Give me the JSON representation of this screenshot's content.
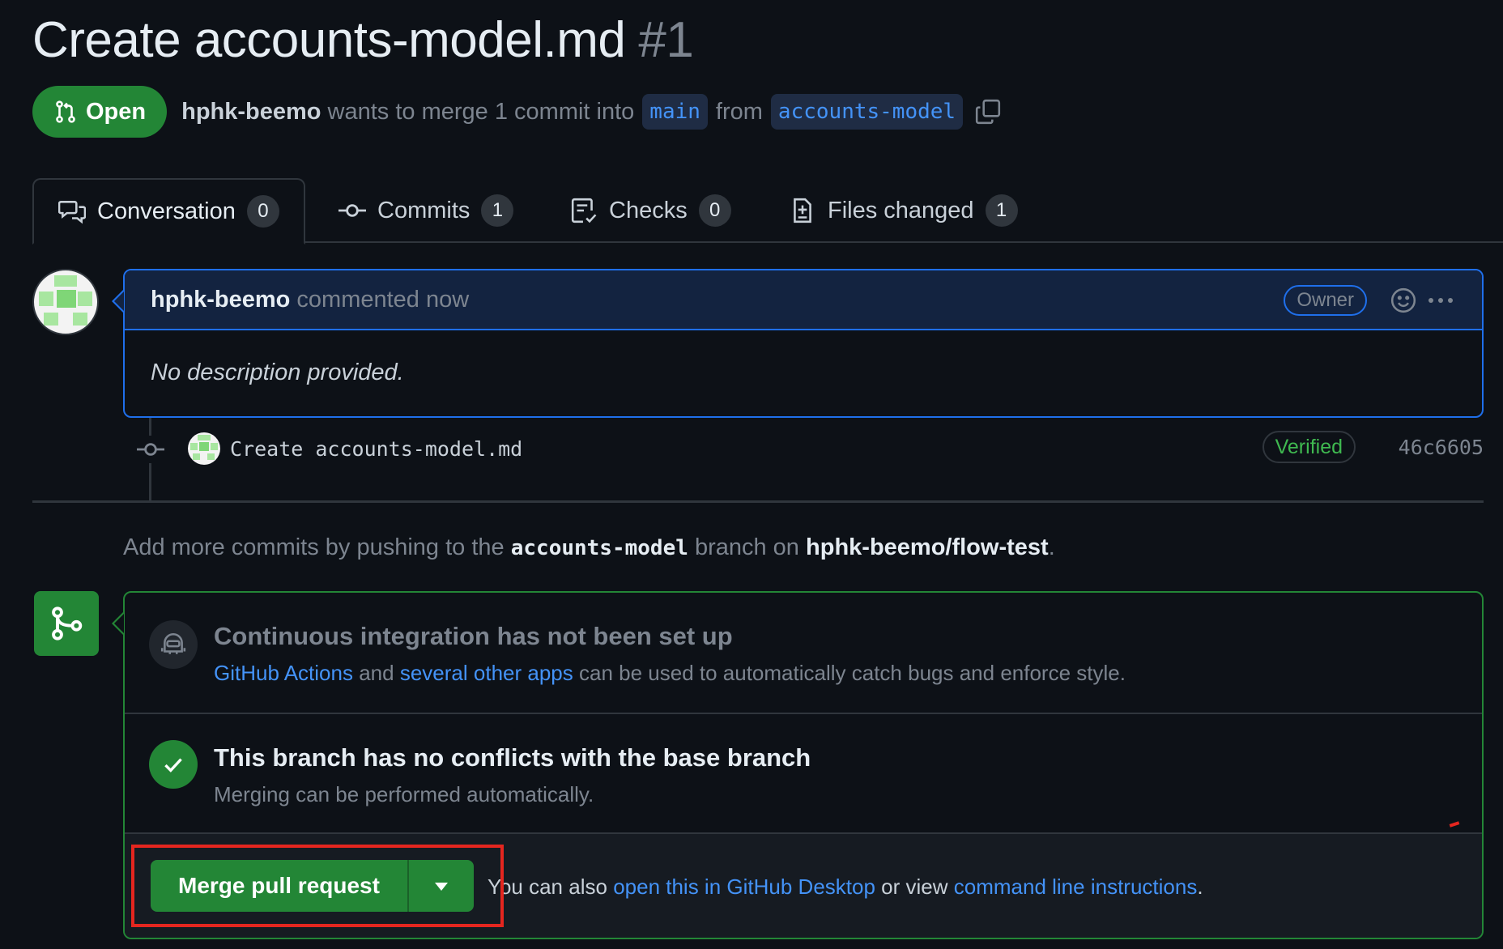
{
  "pr": {
    "title": "Create accounts-model.md",
    "number": "#1",
    "state": "Open",
    "author": "hphk-beemo",
    "summary_mid": "wants to merge 1 commit into",
    "base_branch": "main",
    "from_word": "from",
    "head_branch": "accounts-model"
  },
  "tabs": [
    {
      "label": "Conversation",
      "count": "0",
      "icon": "comment-discussion-icon"
    },
    {
      "label": "Commits",
      "count": "1",
      "icon": "git-commit-icon"
    },
    {
      "label": "Checks",
      "count": "0",
      "icon": "checklist-icon"
    },
    {
      "label": "Files changed",
      "count": "1",
      "icon": "file-diff-icon"
    }
  ],
  "comment": {
    "author": "hphk-beemo",
    "meta": "commented now",
    "role_badge": "Owner",
    "body": "No description provided."
  },
  "commit": {
    "message": "Create accounts-model.md",
    "verified": "Verified",
    "sha": "46c6605"
  },
  "hint": {
    "prefix": "Add more commits by pushing to the",
    "branch": "accounts-model",
    "middle": "branch on",
    "repo": "hphk-beemo/flow-test",
    "suffix": "."
  },
  "checks": {
    "ci_title": "Continuous integration has not been set up",
    "ci_link1": "GitHub Actions",
    "ci_and": "and",
    "ci_link2": "several other apps",
    "ci_rest": "can be used to automatically catch bugs and enforce style.",
    "conflict_title": "This branch has no conflicts with the base branch",
    "conflict_sub": "Merging can be performed automatically."
  },
  "merge": {
    "button_label": "Merge pull request",
    "also_prefix": "You can also",
    "also_link1": "open this in GitHub Desktop",
    "also_mid": "or view",
    "also_link2": "command line instructions",
    "also_suffix": "."
  },
  "colors": {
    "background": "#0d1117",
    "open_green": "#238636",
    "link_blue": "#4493f8",
    "highlight_red": "#e5261f"
  }
}
